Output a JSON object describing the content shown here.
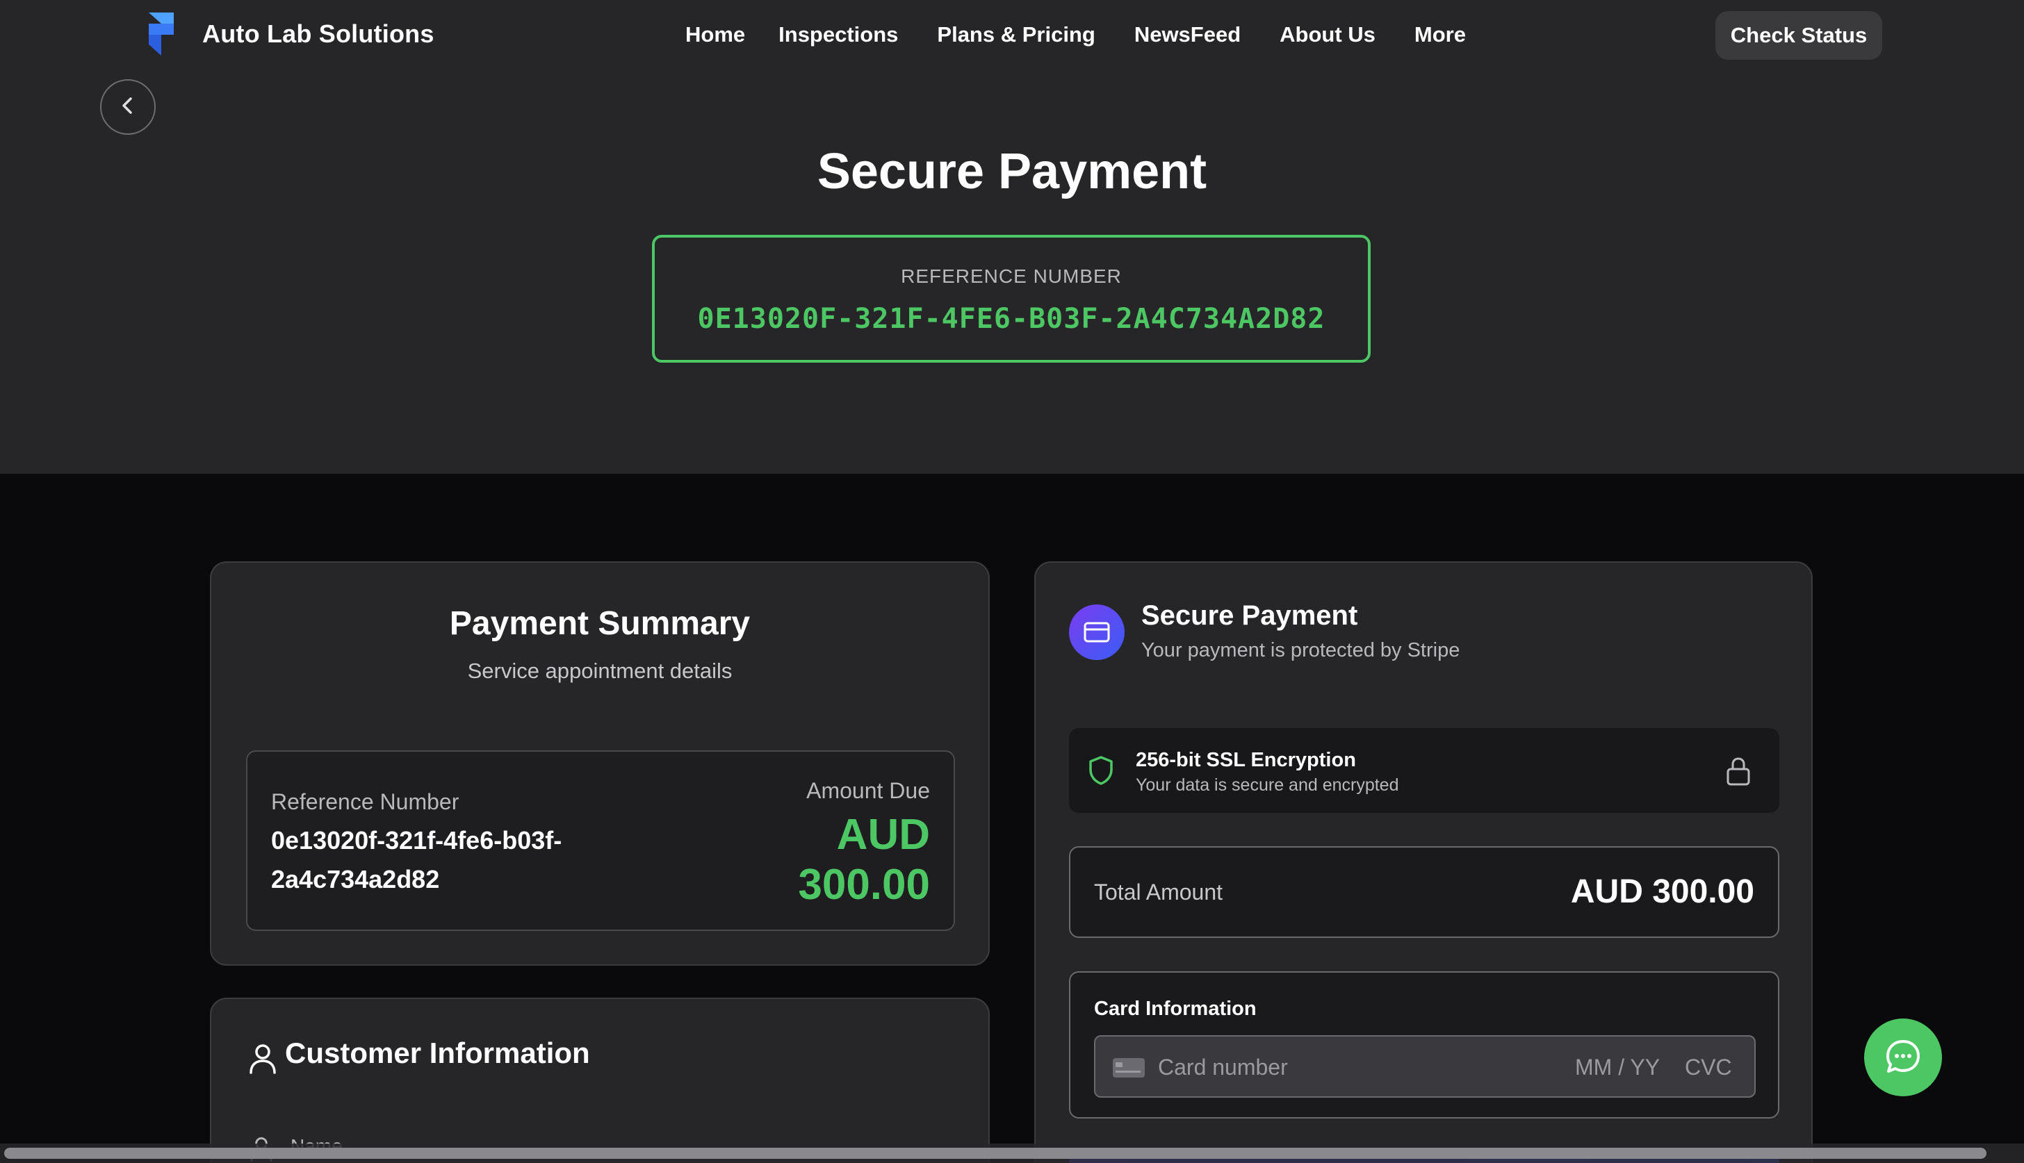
{
  "header": {
    "brand": "Auto Lab Solutions",
    "nav": [
      "Home",
      "Inspections",
      "Plans & Pricing",
      "NewsFeed",
      "About Us",
      "More"
    ],
    "check_status": "Check Status"
  },
  "hero": {
    "title": "Secure Payment",
    "reference_label": "REFERENCE NUMBER",
    "reference_value": "0E13020F-321F-4FE6-B03F-2A4C734A2D82"
  },
  "summary": {
    "title": "Payment Summary",
    "subtitle": "Service appointment details",
    "reference_label": "Reference Number",
    "reference_value": "0e13020f-321f-4fe6-b03f-2a4c734a2d82",
    "amount_label": "Amount Due",
    "amount_currency": "AUD",
    "amount_value": "300.00"
  },
  "customer": {
    "title": "Customer Information",
    "name_label": "Name"
  },
  "payment": {
    "title": "Secure Payment",
    "subtitle": "Your payment is protected by Stripe",
    "ssl_title": "256-bit SSL Encryption",
    "ssl_subtitle": "Your data is secure and encrypted",
    "total_label": "Total Amount",
    "total_value": "AUD 300.00",
    "card_label": "Card Information",
    "card_placeholder": "Card number",
    "expiry_placeholder": "MM / YY",
    "cvc_placeholder": "CVC"
  },
  "colors": {
    "accent_green": "#4cc764",
    "pay_gradient_start": "#7a3df0",
    "pay_gradient_end": "#3b5cf5",
    "header_bg": "#262628",
    "page_bg": "#0a0a0c"
  },
  "icons": {
    "logo": "framer-logo-icon",
    "back": "chevron-left-icon",
    "customer": "user-icon",
    "name": "user-icon",
    "payment": "credit-card-icon",
    "ssl": "shield-icon",
    "lock": "lock-icon",
    "card_field": "credit-card-icon",
    "chat": "chat-bubble-icon"
  }
}
